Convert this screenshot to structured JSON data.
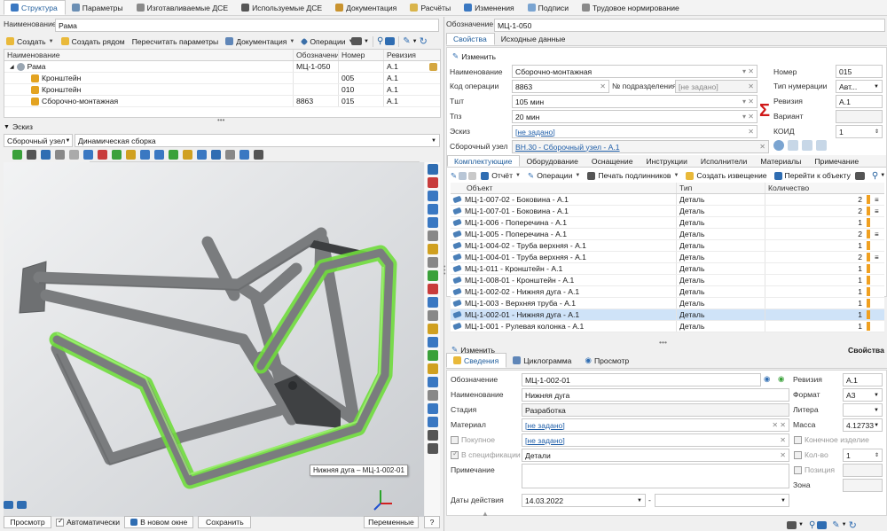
{
  "top_tabs": [
    {
      "label": "Структура",
      "icon": "structure-icon",
      "active": true
    },
    {
      "label": "Параметры",
      "icon": "parameters-icon"
    },
    {
      "label": "Изготавливаемые ДСЕ",
      "icon": "manufactured-icon"
    },
    {
      "label": "Используемые ДСЕ",
      "icon": "used-parts-icon"
    },
    {
      "label": "Документация",
      "icon": "documentation-icon"
    },
    {
      "label": "Расчёты",
      "icon": "calculations-icon"
    },
    {
      "label": "Изменения",
      "icon": "changes-icon"
    },
    {
      "label": "Подписи",
      "icon": "signatures-icon"
    },
    {
      "label": "Трудовое нормирование",
      "icon": "labor-icon"
    }
  ],
  "left": {
    "name_label": "Наименование",
    "name_value": "Рама",
    "toolbar": {
      "create": "Создать",
      "create_near": "Создать рядом",
      "recalc": "Пересчитать параметры",
      "docs": "Документация",
      "ops": "Операции"
    },
    "table": {
      "headers": [
        "Наименование",
        "Обозначение",
        "Номер",
        "Ревизия"
      ],
      "rows": [
        {
          "name": "Рама",
          "designation": "МЦ-1-050",
          "number": "",
          "revision": "A.1",
          "level": 0
        },
        {
          "name": "Кронштейн",
          "designation": "",
          "number": "005",
          "revision": "A.1",
          "level": 1
        },
        {
          "name": "Кронштейн",
          "designation": "",
          "number": "010",
          "revision": "A.1",
          "level": 1
        },
        {
          "name": "Сборочно-монтажная",
          "designation": "8863",
          "number": "015",
          "revision": "A.1",
          "level": 1
        }
      ]
    },
    "sketch_label": "Эскиз",
    "sketch_type": "Сборочный узел",
    "assembly_mode": "Динамическая сборка",
    "tooltip": "Нижняя дуга – МЦ-1-002-01",
    "bottom": {
      "preview": "Просмотр",
      "auto": "Автоматически",
      "new_window": "В новом окне",
      "save": "Сохранить",
      "variables": "Переменные",
      "help": "?"
    }
  },
  "right": {
    "designation_label": "Обозначение",
    "designation_value": "МЦ-1-050",
    "tabs": [
      "Свойства",
      "Исходные данные"
    ],
    "edit": "Изменить",
    "props": {
      "name_label": "Наименование",
      "name_value": "Сборочно-монтажная",
      "opcode_label": "Код операции",
      "opcode_value": "8863",
      "subdiv_label": "№ подразделения",
      "subdiv_value": "[не задано]",
      "tsht_label": "Тшт",
      "tsht_value": "105 мин",
      "tpz_label": "Тпз",
      "tpz_value": "20 мин",
      "sketch_label": "Эскиз",
      "sketch_value": "[не задано]",
      "asm_label": "Сборочный узел",
      "asm_value": "ВН.30 - Сборочный узел - A.1",
      "number_label": "Номер",
      "number_value": "015",
      "numtype_label": "Тип нумерации",
      "numtype_value": "Авт...",
      "revision_label": "Ревизия",
      "revision_value": "A.1",
      "variant_label": "Вариант",
      "variant_value": "",
      "koid_label": "КОИД",
      "koid_value": "1"
    },
    "subtabs": [
      "Комплектующие",
      "Оборудование",
      "Оснащение",
      "Инструкции",
      "Исполнители",
      "Материалы",
      "Примечание"
    ],
    "kit_toolbar": {
      "report": "Отчёт",
      "ops": "Операции",
      "print": "Печать подлинников",
      "notice": "Создать извещение",
      "goto": "Перейти к объекту"
    },
    "kit_headers": [
      "Объект",
      "Тип",
      "Количество"
    ],
    "kit_rows": [
      {
        "obj": "МЦ-1-007-02 - Боковина - A.1",
        "type": "Деталь",
        "qty": "2",
        "menu": true
      },
      {
        "obj": "МЦ-1-007-01 - Боковина - A.1",
        "type": "Деталь",
        "qty": "2",
        "menu": true
      },
      {
        "obj": "МЦ-1-006 - Поперечина - A.1",
        "type": "Деталь",
        "qty": "1",
        "menu": false
      },
      {
        "obj": "МЦ-1-005 - Поперечина - A.1",
        "type": "Деталь",
        "qty": "2",
        "menu": true
      },
      {
        "obj": "МЦ-1-004-02 - Труба верхняя - A.1",
        "type": "Деталь",
        "qty": "1",
        "menu": false
      },
      {
        "obj": "МЦ-1-004-01 - Труба верхняя - A.1",
        "type": "Деталь",
        "qty": "2",
        "menu": true
      },
      {
        "obj": "МЦ-1-011 - Кронштейн - A.1",
        "type": "Деталь",
        "qty": "1",
        "menu": false
      },
      {
        "obj": "МЦ-1-008-01 - Кронштейн - A.1",
        "type": "Деталь",
        "qty": "1",
        "menu": false
      },
      {
        "obj": "МЦ-1-002-02 - Нижняя дуга - A.1",
        "type": "Деталь",
        "qty": "1",
        "menu": false
      },
      {
        "obj": "МЦ-1-003 - Верхняя труба - A.1",
        "type": "Деталь",
        "qty": "1",
        "menu": false
      },
      {
        "obj": "МЦ-1-002-01 - Нижняя дуга - A.1",
        "type": "Деталь",
        "qty": "1",
        "menu": false,
        "selected": true
      },
      {
        "obj": "МЦ-1-001 - Рулевая колонка - A.1",
        "type": "Деталь",
        "qty": "1",
        "menu": false
      }
    ],
    "edit2": "Изменить",
    "props_caption": "Свойства",
    "detail_tabs": [
      "Сведения",
      "Циклограмма",
      "Просмотр"
    ],
    "detail": {
      "designation_label": "Обозначение",
      "designation_value": "МЦ-1-002-01",
      "name_label": "Наименование",
      "name_value": "Нижняя дуга",
      "stage_label": "Стадия",
      "stage_value": "Разработка",
      "material_label": "Материал",
      "material_value": "[не задано]",
      "purchased_label": "Покупное",
      "purchased_value": "[не задано]",
      "inspec_label": "В спецификации",
      "inspec_value": "Детали",
      "note_label": "Примечание",
      "dates_label": "Даты действия",
      "date_from": "14.03.2022",
      "date_dash": "-",
      "revision_label": "Ревизия",
      "revision_value": "A.1",
      "format_label": "Формат",
      "format_value": "A3",
      "litera_label": "Литера",
      "litera_value": "",
      "mass_label": "Масса",
      "mass_value": "4.12733",
      "final_label": "Конечное изделие",
      "qty_label": "Кол-во",
      "qty_value": "1",
      "pos_label": "Позиция",
      "pos_value": "",
      "zone_label": "Зона",
      "zone_value": ""
    }
  },
  "colors": {
    "accent": "#1f5d9c",
    "highlight": "#6fdc3c",
    "orange": "#f0a020",
    "frame": "#7a7c7e"
  }
}
